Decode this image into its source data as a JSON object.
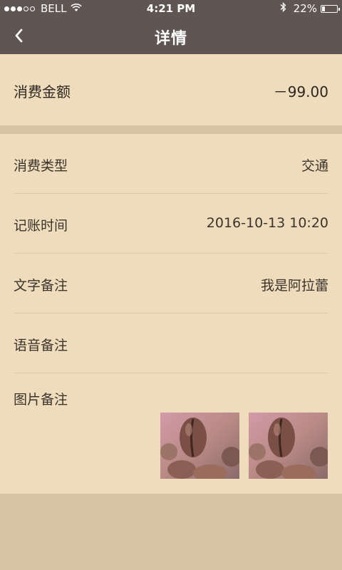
{
  "status_bar": {
    "carrier": "BELL",
    "time": "4:21 PM",
    "battery_text": "22%",
    "battery_level": 0.22,
    "signal_bars_filled": 3,
    "signal_bars_total": 5
  },
  "nav": {
    "title": "详情",
    "back_icon": "chevron-left-icon"
  },
  "amount": {
    "label": "消费金额",
    "value": "－99.00"
  },
  "details": [
    {
      "label": "消费类型",
      "value": "交通"
    },
    {
      "label": "记账时间",
      "value": "2016-10-13 10:20"
    },
    {
      "label": "文字备注",
      "value": "我是阿拉蕾"
    },
    {
      "label": "语音备注",
      "value": ""
    },
    {
      "label": "图片备注",
      "value": ""
    }
  ],
  "photos": [
    {
      "name": "coffee-bean-photo"
    },
    {
      "name": "coffee-bean-photo"
    }
  ],
  "colors": {
    "nav_bg": "#5f5653",
    "content_bg": "#efdcbc",
    "page_bg": "#d6c4a3",
    "text": "#2b2620"
  }
}
